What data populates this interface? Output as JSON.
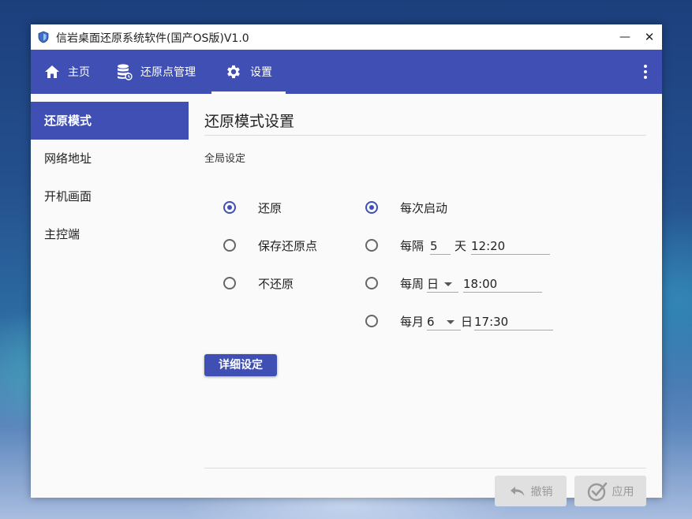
{
  "window": {
    "title": "信岩桌面还原系统软件(国产OS版)V1.0",
    "min_label": "—",
    "close_label": "✕"
  },
  "nav": {
    "tabs": [
      {
        "label": "主页",
        "icon": "home-icon"
      },
      {
        "label": "还原点管理",
        "icon": "database-icon"
      },
      {
        "label": "设置",
        "icon": "gear-icon"
      }
    ],
    "active_tab": "设置",
    "more_icon": "more-vert-icon"
  },
  "sidebar": {
    "items": [
      {
        "label": "还原模式",
        "active": true
      },
      {
        "label": "网络地址",
        "active": false
      },
      {
        "label": "开机画面",
        "active": false
      },
      {
        "label": "主控端",
        "active": false
      }
    ]
  },
  "main": {
    "section_title": "还原模式设置",
    "group_label": "全局设定",
    "mode_options": [
      {
        "label": "还原",
        "selected": true
      },
      {
        "label": "保存还原点",
        "selected": false
      },
      {
        "label": "不还原",
        "selected": false
      }
    ],
    "schedule": {
      "every_boot": {
        "label": "每次启动",
        "selected": true
      },
      "every_n_days": {
        "prefix": "每隔",
        "days": "5",
        "unit": "天",
        "time": "12:20",
        "selected": false
      },
      "weekly": {
        "prefix": "每周",
        "day": "日",
        "time": "18:00",
        "selected": false
      },
      "monthly": {
        "prefix": "每月",
        "day": "6",
        "unit": "日",
        "time": "17:30",
        "selected": false
      }
    },
    "detail_button": "详细设定",
    "undo_button": "撤销",
    "apply_button": "应用"
  },
  "colors": {
    "accent": "#3f4fb3",
    "disabled_bg": "#e0e0e0",
    "disabled_text": "#999999"
  }
}
